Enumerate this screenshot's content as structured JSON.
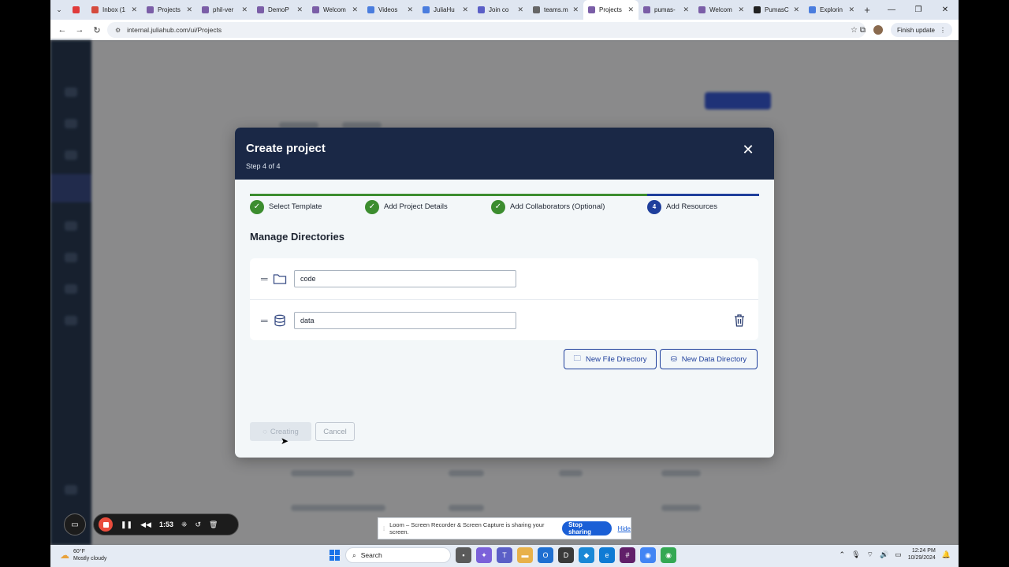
{
  "browser": {
    "tabs": [
      {
        "label": "",
        "color": "#e03b3b"
      },
      {
        "label": "Inbox (1",
        "color": "#d54b3d"
      },
      {
        "label": "Projects",
        "color": "#7b5ea7"
      },
      {
        "label": "phil-ver",
        "color": "#7b5ea7"
      },
      {
        "label": "DemoP",
        "color": "#7b5ea7"
      },
      {
        "label": "Welcom",
        "color": "#7b5ea7"
      },
      {
        "label": "Videos",
        "color": "#4a7dde"
      },
      {
        "label": "JuliaHu",
        "color": "#4a7dde"
      },
      {
        "label": "Join co",
        "color": "#5b5fc7"
      },
      {
        "label": "teams.m",
        "color": "#666666"
      },
      {
        "label": "Projects",
        "color": "#7b5ea7",
        "active": true
      },
      {
        "label": "pumas-",
        "color": "#7b5ea7"
      },
      {
        "label": "Welcom",
        "color": "#7b5ea7"
      },
      {
        "label": "PumasC",
        "color": "#222222"
      },
      {
        "label": "Explorin",
        "color": "#4a7dde"
      }
    ],
    "url": "internal.juliahub.com/ui/Projects",
    "finish_update": "Finish update"
  },
  "modal": {
    "title": "Create project",
    "step": "Step 4 of 4",
    "steps": [
      {
        "label": "Select Template",
        "status": "done"
      },
      {
        "label": "Add Project Details",
        "status": "done"
      },
      {
        "label": "Add Collaborators (Optional)",
        "status": "done"
      },
      {
        "label": "Add Resources",
        "status": "current",
        "number": "4"
      }
    ],
    "section_title": "Manage Directories",
    "directories": [
      {
        "name": "code",
        "type": "folder-icon"
      },
      {
        "name": "data",
        "type": "database-icon"
      }
    ],
    "new_file_dir": "New File Directory",
    "new_data_dir": "New Data Directory",
    "creating": "Creating",
    "cancel": "Cancel"
  },
  "loom": {
    "time": "1:53",
    "notice": "Loom – Screen Recorder & Screen Capture is sharing your screen.",
    "stop": "Stop sharing",
    "hide": "Hide"
  },
  "taskbar": {
    "temp": "60°F",
    "weather": "Mostly cloudy",
    "search": "Search",
    "time": "12:24 PM",
    "date": "10/29/2024"
  },
  "colors": {
    "accent": "#1f3f9c",
    "success": "#3c8d2f",
    "header": "#1a2846"
  }
}
